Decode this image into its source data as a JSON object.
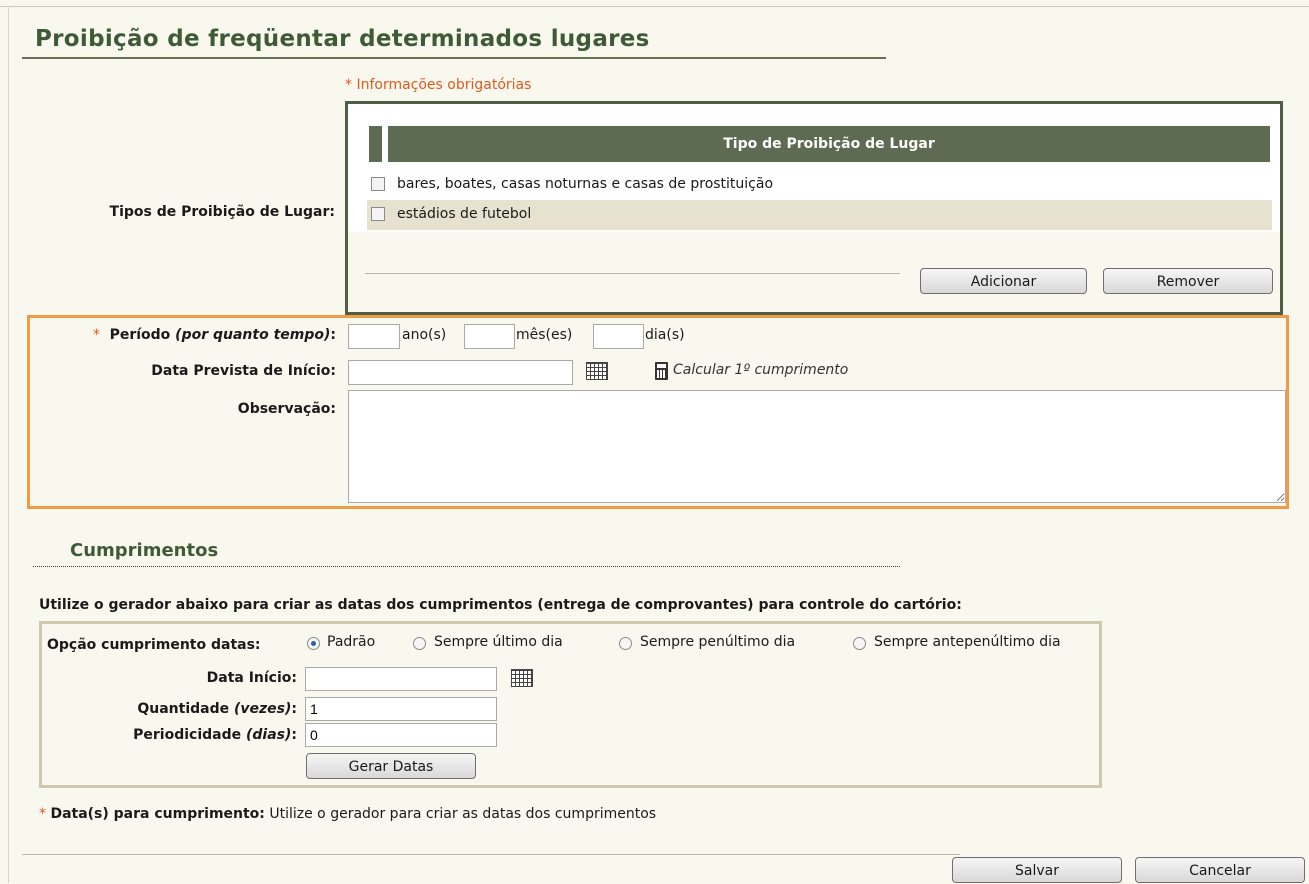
{
  "title": "Proibição de freqüentar determinados lugares",
  "required_note": "* Informações obrigatórias",
  "tipos": {
    "label": "Tipos de Proibição de Lugar:",
    "table_header": "Tipo de Proibição de Lugar",
    "rows": [
      {
        "label": "bares, boates, casas noturnas e casas de prostituição",
        "checked": false
      },
      {
        "label": "estádios de futebol",
        "checked": false
      }
    ],
    "add_label": "Adicionar",
    "remove_label": "Remover"
  },
  "periodo": {
    "star": "*",
    "label": "Período",
    "label_em": "(por quanto tempo)",
    "label_colon": ":",
    "unit_years": "ano(s)",
    "unit_months": "mês(es)",
    "unit_days": "dia(s)",
    "years": "",
    "months": "",
    "days": ""
  },
  "data_prevista": {
    "label": "Data Prevista de Início:",
    "value": "",
    "calc_label": "Calcular 1º cumprimento"
  },
  "observacao": {
    "label": "Observação:",
    "value": ""
  },
  "cumprimentos": {
    "section_title": "Cumprimentos",
    "note": "Utilize o gerador abaixo para criar as datas dos cumprimentos (entrega de comprovantes) para controle do cartório:",
    "opcao_label": "Opção cumprimento datas:",
    "options": [
      {
        "label": "Padrão",
        "selected": true
      },
      {
        "label": "Sempre último dia",
        "selected": false
      },
      {
        "label": "Sempre penúltimo dia",
        "selected": false
      },
      {
        "label": "Sempre antepenúltimo dia",
        "selected": false
      }
    ],
    "data_inicio_label": "Data Início:",
    "data_inicio_value": "",
    "quantidade_label": "Quantidade",
    "quantidade_em": "(vezes)",
    "quantidade_value": "1",
    "periodicidade_label": "Periodicidade",
    "periodicidade_em": "(dias)",
    "periodicidade_value": "0",
    "gerar_label": "Gerar Datas"
  },
  "datas": {
    "star": "*",
    "label": "Data(s) para cumprimento:",
    "value": "Utilize o gerador para criar as datas dos cumprimentos"
  },
  "actions": {
    "save_label": "Salvar",
    "cancel_label": "Cancelar"
  },
  "colors": {
    "title": "#3f5a36",
    "table_header": "#5d6b52",
    "required": "#e2581f",
    "highlight_border": "#f29b46"
  }
}
